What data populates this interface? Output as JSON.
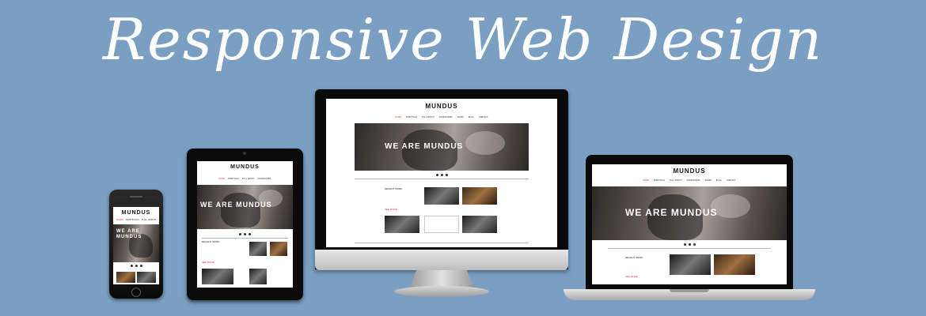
{
  "headline": "Responsive Web Design",
  "site": {
    "logo": "MUNDUS",
    "hero_text": "WE ARE MUNDUS",
    "nav_phone": [
      "HOME",
      "PORTFOLIO",
      "FULL WIDTH"
    ],
    "nav_full": [
      "HOME",
      "PORTFOLIO",
      "FULL WIDTH",
      "SHORTCODES",
      "PAGES",
      "BLOG",
      "CONTACT"
    ],
    "recent_work": "RECENT WORK",
    "more": "SEE MORE"
  },
  "colors": {
    "background": "#7a9fc3",
    "accent": "#e2304a"
  }
}
